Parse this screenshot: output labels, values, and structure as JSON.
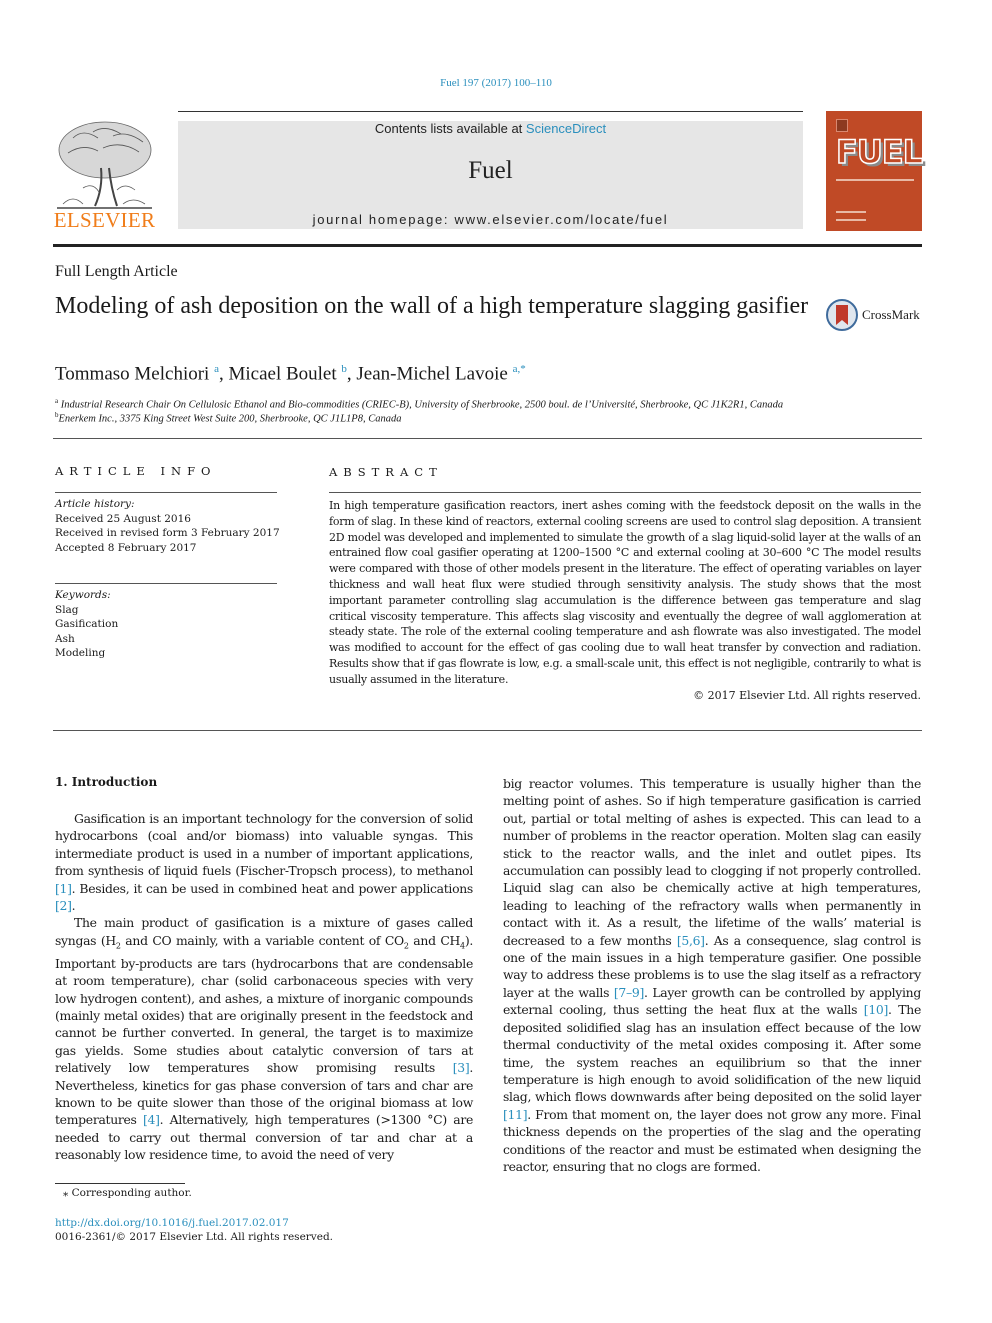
{
  "running_head": "Fuel 197 (2017) 100–110",
  "masthead": {
    "publisher_logo_text": "ELSEVIER",
    "contents_prefix": "Contents lists available at ",
    "contents_link": "ScienceDirect",
    "journal_title": "Fuel",
    "homepage_label": "journal homepage: www.elsevier.com/locate/fuel",
    "cover_title": "FUEL",
    "cover_color": "#c04a26",
    "accent_color": "#2a8fbd",
    "elsevier_color": "#f07d1a"
  },
  "article": {
    "type": "Full Length Article",
    "title": "Modeling of ash deposition on the wall of a high temperature slagging gasifier",
    "crossmark_label": "CrossMark",
    "authors": [
      {
        "name": "Tommaso Melchiori",
        "affil": "a"
      },
      {
        "name": "Micael Boulet",
        "affil": "b"
      },
      {
        "name": "Jean-Michel Lavoie",
        "affil": "a,*"
      }
    ],
    "affiliations": [
      {
        "key": "a",
        "text": "Industrial Research Chair On Cellulosic Ethanol and Bio-commodities (CRIEC-B), University of Sherbrooke, 2500 boul. de l’Université, Sherbrooke, QC J1K2R1, Canada"
      },
      {
        "key": "b",
        "text": "Enerkem Inc., 3375 King Street West Suite 200, Sherbrooke, QC J1L1P8, Canada"
      }
    ]
  },
  "article_info": {
    "heading": "ARTICLE INFO",
    "history_label": "Article history:",
    "history": [
      "Received 25 August 2016",
      "Received in revised form 3 February 2017",
      "Accepted 8 February 2017"
    ],
    "keywords_label": "Keywords:",
    "keywords": [
      "Slag",
      "Gasification",
      "Ash",
      "Modeling"
    ]
  },
  "abstract": {
    "heading": "ABSTRACT",
    "text": "In high temperature gasification reactors, inert ashes coming with the feedstock deposit on the walls in the form of slag. In these kind of reactors, external cooling screens are used to control slag deposition. A transient 2D model was developed and implemented to simulate the growth of a slag liquid-solid layer at the walls of an entrained flow coal gasifier operating at 1200–1500 °C and external cooling at 30–600 °C The model results were compared with those of other models present in the literature. The effect of operating variables on layer thickness and wall heat flux were studied through sensitivity analysis. The study shows that the most important parameter controlling slag accumulation is the difference between gas temperature and slag critical viscosity temperature. This affects slag viscosity and eventually the degree of wall agglomeration at steady state. The role of the external cooling temperature and ash flowrate was also investigated. The model was modified to account for the effect of gas cooling due to wall heat transfer by convection and radiation. Results show that if gas flowrate is low, e.g. a small-scale unit, this effect is not negligible, contrarily to what is usually assumed in the literature.",
    "copyright": "© 2017 Elsevier Ltd. All rights reserved."
  },
  "intro": {
    "heading": "1. Introduction",
    "p1": {
      "a": "Gasification is an important technology for the conversion of solid hydrocarbons (coal and/or biomass) into valuable syngas. This intermediate product is used in a number of important applications, from synthesis of liquid fuels (Fischer-Tropsch process), to methanol ",
      "ref1": "[1]",
      "b": ". Besides, it can be used in combined heat and power applications ",
      "ref2": "[2]",
      "c": "."
    },
    "p2": {
      "a": "The main product of gasification is a mixture of gases called syngas (H",
      "b": " and CO mainly, with a variable content of CO",
      "c": " and CH",
      "d": "). Important by-products are tars (hydrocarbons that are condensable at room temperature), char (solid carbonaceous species with very low hydrogen content), and ashes, a mixture of inorganic compounds (mainly metal oxides) that are originally present in the feedstock and cannot be further converted. In general, the target is to maximize gas yields. Some studies about catalytic conversion of tars at relatively low temperatures show promising results ",
      "ref3": "[3]",
      "e": ". Nevertheless, kinetics for gas phase conversion of tars and char are known to be quite slower than those of the original biomass at low temperatures ",
      "ref4": "[4]",
      "f": ". Alternatively, high temperatures (>1300 °C) are needed to carry out thermal conversion of tar and char at a reasonably low residence time, to avoid the need of very big reactor volumes. This temperature is usually higher than the melting point of ashes. So if high temperature gasification is carried out, partial or total melting of ashes is expected. This can lead to a number of problems in the reactor operation. Molten slag can easily stick to the reactor walls, and the inlet and outlet pipes. Its accumulation can possibly lead to clogging if not properly controlled. Liquid slag can also be chemically active at high temperatures, leading to leaching of the refractory walls when permanently in contact with it. As a result, the lifetime of the walls’ material is decreased to a few months ",
      "sub2": "2",
      "sub4": "4"
    },
    "col2": {
      "ref56": "[5,6]",
      "a": ". As a consequence, slag control is one of the main issues in a high temperature gasifier. One possible way to address these problems is to use the slag itself as a refractory layer at the walls ",
      "ref79": "[7–9]",
      "b": ". Layer growth can be controlled by applying external cooling, thus setting the heat flux at the walls ",
      "ref10": "[10]",
      "c": ". The deposited solidified slag has an insulation effect because of the low thermal conductivity of the metal oxides composing it. After some time, the system reaches an equilibrium so that the inner temperature is high enough to avoid solidification of the new liquid slag, which flows downwards after being deposited on the solid layer ",
      "ref11": "[11]",
      "d": ". From that moment on, the layer does not grow any more. Final thickness depends on the properties of the slag and the operating conditions of the reactor and must be estimated when designing the reactor, ensuring that no clogs are formed."
    }
  },
  "footer": {
    "footnote": "⁎ Corresponding author.",
    "doi": "http://dx.doi.org/10.1016/j.fuel.2017.02.017",
    "issn": "0016-2361/© 2017 Elsevier Ltd. All rights reserved."
  }
}
